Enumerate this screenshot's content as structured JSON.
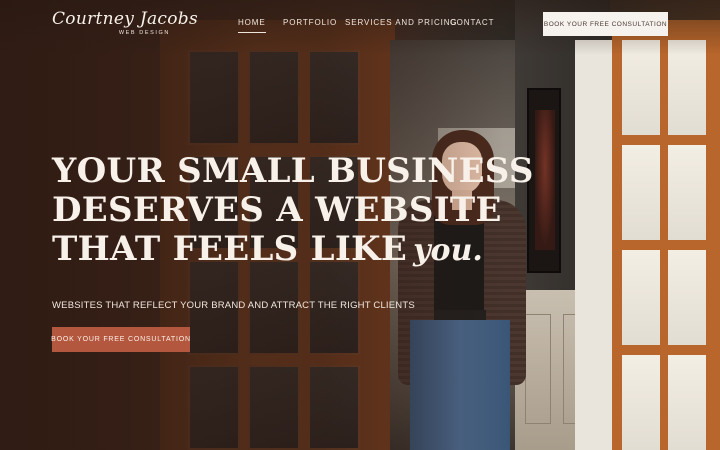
{
  "brand": {
    "name_script": "Courtney Jacobs",
    "subtitle": "WEB DESIGN"
  },
  "nav": {
    "items": [
      {
        "label": "HOME",
        "active": true
      },
      {
        "label": "PORTFOLIO",
        "active": false
      },
      {
        "label": "SERVICES AND PRICING",
        "active": false
      },
      {
        "label": "CONTACT",
        "active": false
      }
    ],
    "cta_label": "BOOK YOUR FREE CONSULTATION"
  },
  "hero": {
    "title_line_1": "YOUR SMALL BUSINESS",
    "title_line_2": "DESERVES A WEBSITE",
    "title_line_3": "THAT FEELS LIKE",
    "title_script": "you.",
    "subtitle": "WEBSITES THAT REFLECT YOUR BRAND AND ATTRACT THE RIGHT CLIENTS",
    "cta_label": "BOOK YOUR FREE CONSULTATION"
  },
  "colors": {
    "accent": "#b3583f",
    "header_button_bg": "#f6f2ee",
    "text_light": "#f8f1ea"
  }
}
